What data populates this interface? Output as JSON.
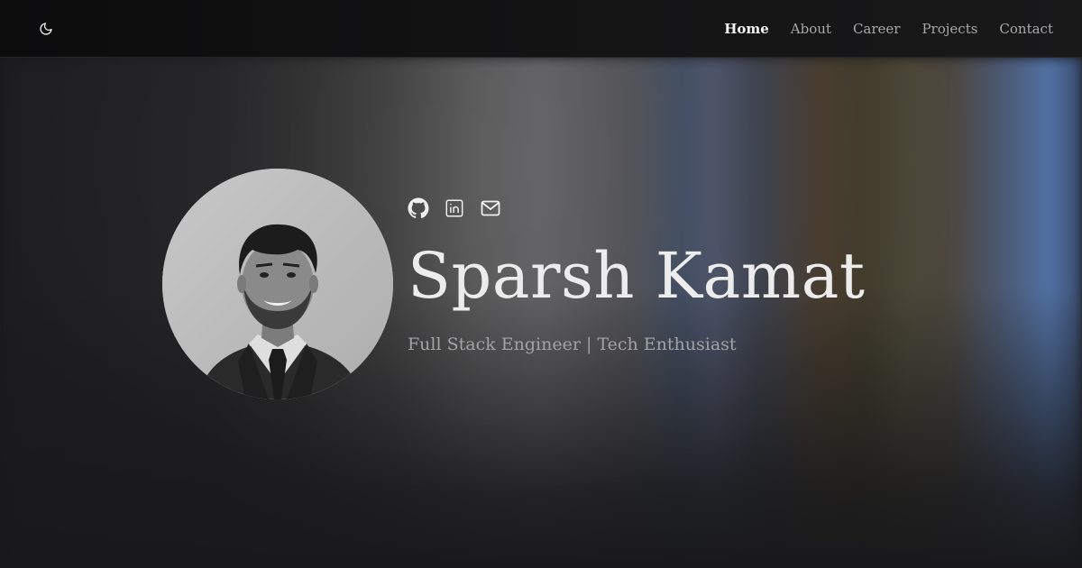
{
  "nav": {
    "theme_toggle_icon": "moon-icon",
    "links": [
      {
        "label": "Home",
        "active": true
      },
      {
        "label": "About",
        "active": false
      },
      {
        "label": "Career",
        "active": false
      },
      {
        "label": "Projects",
        "active": false
      },
      {
        "label": "Contact",
        "active": false
      }
    ]
  },
  "hero": {
    "avatar_icon": "profile-photo",
    "socials": [
      {
        "icon": "github-icon"
      },
      {
        "icon": "linkedin-icon"
      },
      {
        "icon": "mail-icon"
      }
    ],
    "name": "Sparsh Kamat",
    "tagline": "Full Stack Engineer | Tech Enthusiast"
  },
  "colors": {
    "background": "#19191b",
    "text_primary": "#ececec",
    "text_secondary": "#a3a3a6"
  }
}
